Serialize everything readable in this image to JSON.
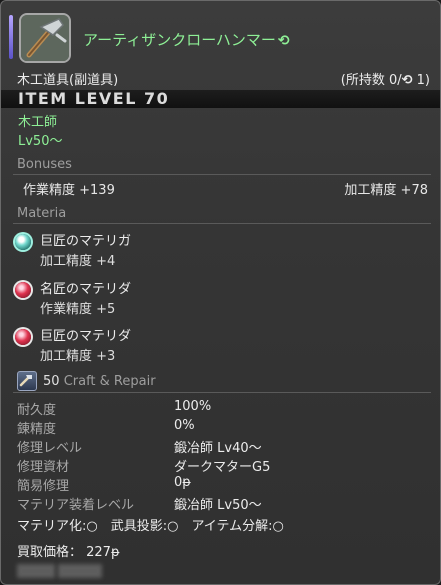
{
  "header": {
    "item_name": "アーティザンクローハンマー",
    "hq_symbol": "⟲",
    "icon": "claw-hammer-icon"
  },
  "category": "木工道具(副道具)",
  "owned": {
    "prefix": "(所持数 0/",
    "hq_symbol": "⟲",
    "suffix": " 1)"
  },
  "item_level": "ITEM LEVEL 70",
  "job": "木工師",
  "level": "Lv50〜",
  "bonuses": {
    "title": "Bonuses",
    "left": "作業精度 +139",
    "right": "加工精度 +78"
  },
  "materia": {
    "title": "Materia",
    "slots": [
      {
        "name": "巨匠のマテリガ",
        "stat": "加工精度 +4",
        "color": "green"
      },
      {
        "name": "名匠のマテリダ",
        "stat": "作業精度 +5",
        "color": "red"
      },
      {
        "name": "巨匠のマテリダ",
        "stat": "加工精度 +3",
        "color": "red"
      }
    ]
  },
  "craft_repair": {
    "num": "50",
    "label": "Craft & Repair",
    "icon": "craft-repair-icon"
  },
  "details": [
    {
      "key": "耐久度",
      "value": "100%"
    },
    {
      "key": "錬精度",
      "value": "0%"
    },
    {
      "key": "修理レベル",
      "value": "鍛冶師 Lv40〜"
    },
    {
      "key": "修理資材",
      "value": "ダークマターG5"
    },
    {
      "key": "簡易修理",
      "value": "0ᵽ"
    },
    {
      "key": "マテリア装着レベル",
      "value": "鍛冶師 Lv50〜"
    }
  ],
  "flags": "マテリア化:○　武具投影:○　アイテム分解:○",
  "sell_price": "買取価格： 227ᵽ",
  "colors": {
    "accent_green": "#8ef096",
    "rarity": "#7b6ee0"
  }
}
